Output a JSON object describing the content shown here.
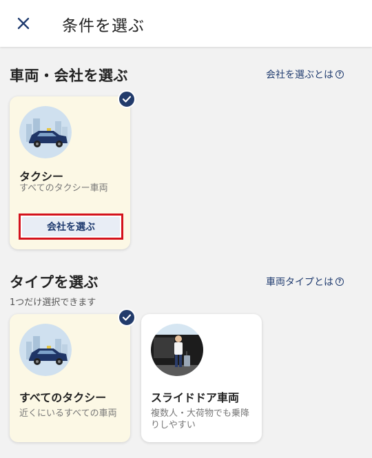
{
  "header": {
    "title": "条件を選ぶ",
    "close_icon": "close-icon"
  },
  "vehicle_section": {
    "title": "車両・会社を選ぶ",
    "help_link": "会社を選ぶとは",
    "card": {
      "name": "タクシー",
      "description": "すべてのタクシー車両",
      "company_button": "会社を選ぶ",
      "selected": true
    }
  },
  "type_section": {
    "title": "タイプを選ぶ",
    "help_link": "車両タイプとは",
    "subtitle": "1つだけ選択できます",
    "cards": [
      {
        "name": "すべてのタクシー",
        "description": "近くにいるすべての車両",
        "selected": true
      },
      {
        "name": "スライドドア車両",
        "description": "複数人・大荷物でも乗降りしやすい",
        "selected": false
      }
    ]
  },
  "colors": {
    "accent": "#223b6b",
    "selected_bg": "#fcf8e5",
    "highlight_border": "#d4121c"
  }
}
